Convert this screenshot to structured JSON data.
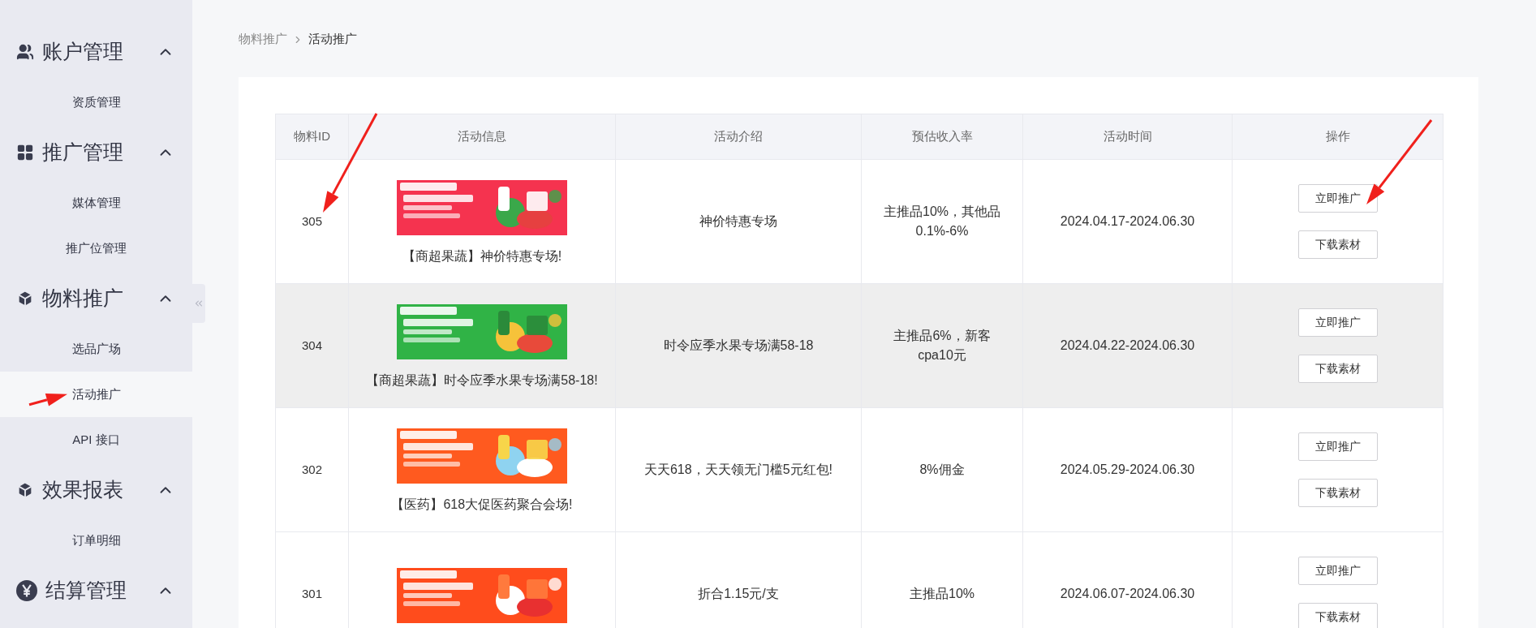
{
  "sidebar": {
    "groups": [
      {
        "kind": "users",
        "label": "账户管理",
        "expanded": true,
        "items": [
          {
            "label": "资质管理",
            "selected": false
          }
        ]
      },
      {
        "kind": "grid",
        "label": "推广管理",
        "expanded": true,
        "items": [
          {
            "label": "媒体管理",
            "selected": false
          },
          {
            "label": "推广位管理",
            "selected": false
          }
        ]
      },
      {
        "kind": "box",
        "label": "物料推广",
        "expanded": true,
        "items": [
          {
            "label": "选品广场",
            "selected": false
          },
          {
            "label": "活动推广",
            "selected": true
          },
          {
            "label": "API 接口",
            "selected": false
          }
        ]
      },
      {
        "kind": "box",
        "label": "效果报表",
        "expanded": true,
        "items": [
          {
            "label": "订单明细",
            "selected": false
          }
        ]
      },
      {
        "kind": "yen",
        "label": "结算管理",
        "expanded": true
      }
    ]
  },
  "breadcrumb": [
    "物料推广",
    "活动推广"
  ],
  "table": {
    "columns": [
      "物料ID",
      "活动信息",
      "活动介绍",
      "预估收入率",
      "活动时间",
      "操作"
    ],
    "rows": [
      {
        "id": "305",
        "title": "【商超果蔬】神价特惠专场!",
        "intro": "神价特惠专场",
        "rate": "主推品10%，其他品0.1%-6%",
        "time": "2024.04.17-2024.06.30",
        "highlighted": false,
        "actions": [
          "立即推广",
          "下载素材"
        ]
      },
      {
        "id": "304",
        "title": "【商超果蔬】时令应季水果专场满58-18!",
        "intro": "时令应季水果专场满58-18",
        "rate": "主推品6%，新客cpa10元",
        "time": "2024.04.22-2024.06.30",
        "highlighted": true,
        "actions": [
          "立即推广",
          "下载素材"
        ]
      },
      {
        "id": "302",
        "title": "【医药】618大促医药聚合会场!",
        "intro": "天天618，天天领无门槛5元红包!",
        "rate": "8%佣金",
        "time": "2024.05.29-2024.06.30",
        "highlighted": false,
        "actions": [
          "立即推广",
          "下载素材"
        ]
      },
      {
        "id": "301",
        "intro": "折合1.15元/支",
        "rate": "主推品10%",
        "time": "2024.06.07-2024.06.30",
        "highlighted": false,
        "actions": [
          "立即推广",
          "下载素材"
        ]
      }
    ]
  }
}
